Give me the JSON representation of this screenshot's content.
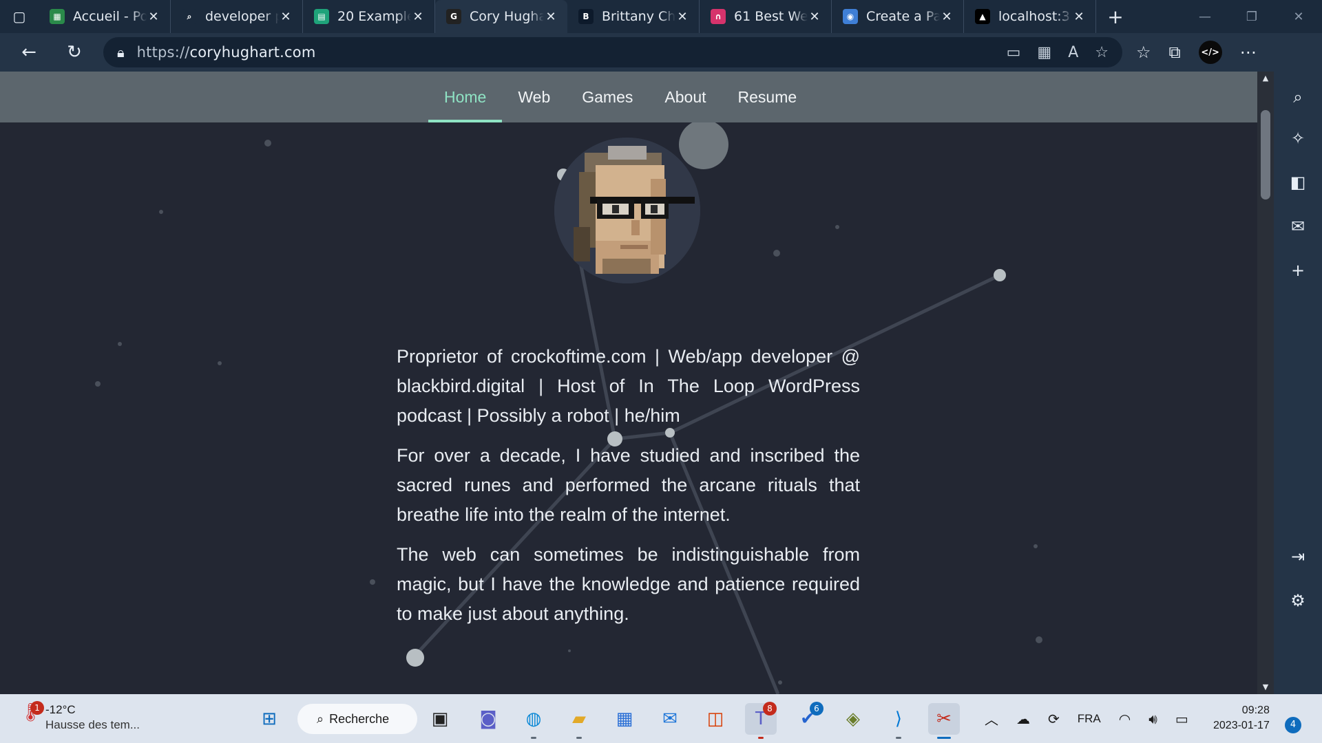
{
  "browser": {
    "tabs": [
      {
        "title": "Accueil - Po",
        "fav_color": "#2a8a4a",
        "fav_glyph": "▦"
      },
      {
        "title": "developer p",
        "fav_color": "#1b2a3c",
        "fav_glyph": "⌕"
      },
      {
        "title": "20 Example",
        "fav_color": "#1fa37a",
        "fav_glyph": "▤"
      },
      {
        "title": "Cory Hugha",
        "fav_color": "#222",
        "fav_glyph": "G"
      },
      {
        "title": "Brittany Chi",
        "fav_color": "#0d1a2b",
        "fav_glyph": "B"
      },
      {
        "title": "61 Best We",
        "fav_color": "#d6336c",
        "fav_glyph": "∩"
      },
      {
        "title": "Create a Pa",
        "fav_color": "#3f7fd6",
        "fav_glyph": "◉"
      },
      {
        "title": "localhost:3",
        "fav_color": "#000",
        "fav_glyph": "▲"
      }
    ],
    "active_tab": 3,
    "url_proto": "https://",
    "url_host": "coryhughart.com"
  },
  "site": {
    "nav": [
      "Home",
      "Web",
      "Games",
      "About",
      "Resume"
    ],
    "current": "Home",
    "bio": [
      "Proprietor of crockoftime.com | Web/app developer @ blackbird.digital | Host of In The Loop WordPress podcast | Possibly a robot | he/him",
      "For over a decade, I have studied and inscribed the sacred runes and performed the arcane rituals that breathe life into the realm of the internet.",
      "The web can sometimes be indistinguishable from magic, but I have the knowledge and patience required to make just about anything."
    ]
  },
  "taskbar": {
    "weather_badge": "1",
    "temp": "-12°C",
    "weather_desc": "Hausse des tem...",
    "search_label": "Recherche",
    "teams_count": "8",
    "todo_count": "6",
    "lang": "FRA",
    "time": "09:28",
    "date": "2023-01-17",
    "notifications": "4"
  },
  "colors": {
    "accent": "#8fe3c4",
    "page_bg": "#232733",
    "nav_bg": "#5c666d"
  }
}
